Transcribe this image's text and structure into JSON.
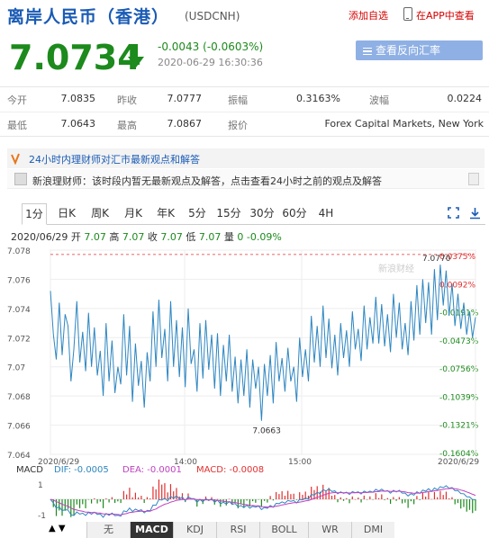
{
  "header": {
    "title": "离岸人民币（香港）",
    "code": "(USDCNH)",
    "add_favorite": "添加自选",
    "open_app": "在APP中查看"
  },
  "quote": {
    "price": "7.0734",
    "change": "-0.0043 (-0.0603%)",
    "time": "2020-06-29 16:30:36",
    "reverse_button": "查看反向汇率"
  },
  "stats": {
    "row1": [
      {
        "label": "今开",
        "value": "7.0835"
      },
      {
        "label": "昨收",
        "value": "7.0777"
      },
      {
        "label": "振幅",
        "value": "0.3163%"
      },
      {
        "label": "波幅",
        "value": "0.0224"
      }
    ],
    "row2": [
      {
        "label": "最低",
        "value": "7.0643"
      },
      {
        "label": "最高",
        "value": "7.0867"
      },
      {
        "label": "报价",
        "value": "Forex Capital Markets, New York"
      }
    ]
  },
  "news": {
    "header": "24小时内理财师对汇市最新观点和解答",
    "item": "新浪理财师：该时段内暂无最新观点及解答，点击查看24小时之前的观点及解答"
  },
  "tabs": [
    "1分",
    "日K",
    "周K",
    "月K",
    "年K",
    "5分",
    "15分",
    "30分",
    "60分",
    "4H"
  ],
  "active_tab": "1分",
  "quote_line": {
    "date": "2020/06/29",
    "open_label": "开",
    "open": "7.07",
    "high_label": "高",
    "high": "7.07",
    "close_label": "收",
    "close": "7.07",
    "low_label": "低",
    "low": "7.07",
    "volume_label": "量",
    "volume": "0",
    "pct": "-0.09%"
  },
  "colors": {
    "up": "#e23030",
    "down": "#1c8a1c",
    "line": "#2e86c1",
    "title": "#1a5bb5"
  },
  "chart_data": {
    "type": "line",
    "y_ticks": [
      "7.078",
      "7.076",
      "7.074",
      "7.072",
      "7.07",
      "7.068",
      "7.066",
      "7.064"
    ],
    "pct_ticks": [
      "0.0375%",
      "0.0092%",
      "-0.0191%",
      "-0.0473%",
      "-0.0756%",
      "-0.1039%",
      "-0.1321%",
      "-0.1604%"
    ],
    "x_ticks": [
      "2020/6/29",
      "14:00",
      "15:00",
      "2020/6/29"
    ],
    "ylim": [
      7.064,
      7.078
    ],
    "prev_close": 7.0777,
    "max_label": "7.0770",
    "min_label": "7.0663",
    "watermark": "新浪财经",
    "values": [
      7.0752,
      7.0722,
      7.0705,
      7.0744,
      7.0708,
      7.0736,
      7.0728,
      7.069,
      7.0712,
      7.0745,
      7.0703,
      7.0724,
      7.0697,
      7.0737,
      7.07,
      7.0727,
      7.0694,
      7.0711,
      7.068,
      7.073,
      7.069,
      7.0718,
      7.0682,
      7.07,
      7.0688,
      7.0736,
      7.0694,
      7.0728,
      7.0676,
      7.0716,
      7.0687,
      7.0704,
      7.0672,
      7.071,
      7.069,
      7.0738,
      7.07,
      7.0746,
      7.0706,
      7.0726,
      7.069,
      7.0745,
      7.07,
      7.0732,
      7.0693,
      7.0727,
      7.0686,
      7.074,
      7.0702,
      7.0712,
      7.0683,
      7.073,
      7.0692,
      7.0732,
      7.0698,
      7.0722,
      7.0685,
      7.0723,
      7.068,
      7.0715,
      7.069,
      7.0722,
      7.0683,
      7.0707,
      7.0675,
      7.0705,
      7.068,
      7.0712,
      7.0672,
      7.0705,
      7.0685,
      7.07,
      7.0663,
      7.0702,
      7.068,
      7.0708,
      7.0675,
      7.0717,
      7.069,
      7.0706,
      7.0683,
      7.0713,
      7.069,
      7.07,
      7.0676,
      7.072,
      7.0693,
      7.0712,
      7.069,
      7.0735,
      7.0703,
      7.0728,
      7.07,
      7.0742,
      7.0706,
      7.0733,
      7.0699,
      7.0722,
      7.0694,
      7.073,
      7.0706,
      7.0725,
      7.07,
      7.0738,
      7.0712,
      7.0726,
      7.0704,
      7.0742,
      7.0712,
      7.0734,
      7.0716,
      7.0748,
      7.0716,
      7.0743,
      7.0714,
      7.0736,
      7.071,
      7.075,
      7.072,
      7.0744,
      7.0712,
      7.073,
      7.0708,
      7.0745,
      7.0718,
      7.0756,
      7.0722,
      7.076,
      7.073,
      7.0758,
      7.0722,
      7.0767,
      7.0732,
      7.077,
      7.0742,
      7.0766,
      7.0735,
      7.0757,
      7.0728,
      7.075,
      7.0726,
      7.0744,
      7.0722,
      7.0738,
      7.072,
      7.0734
    ],
    "macd_labels": {
      "name": "MACD",
      "dif": "DIF: -0.0005",
      "dea": "DEA: -0.0001",
      "macd": "MACD: -0.0008"
    },
    "macd_ticks": [
      "1",
      "-1"
    ]
  },
  "indicator_tabs": [
    "无",
    "MACD",
    "KDJ",
    "RSI",
    "BOLL",
    "WR",
    "DMI"
  ],
  "active_indicator": "MACD"
}
